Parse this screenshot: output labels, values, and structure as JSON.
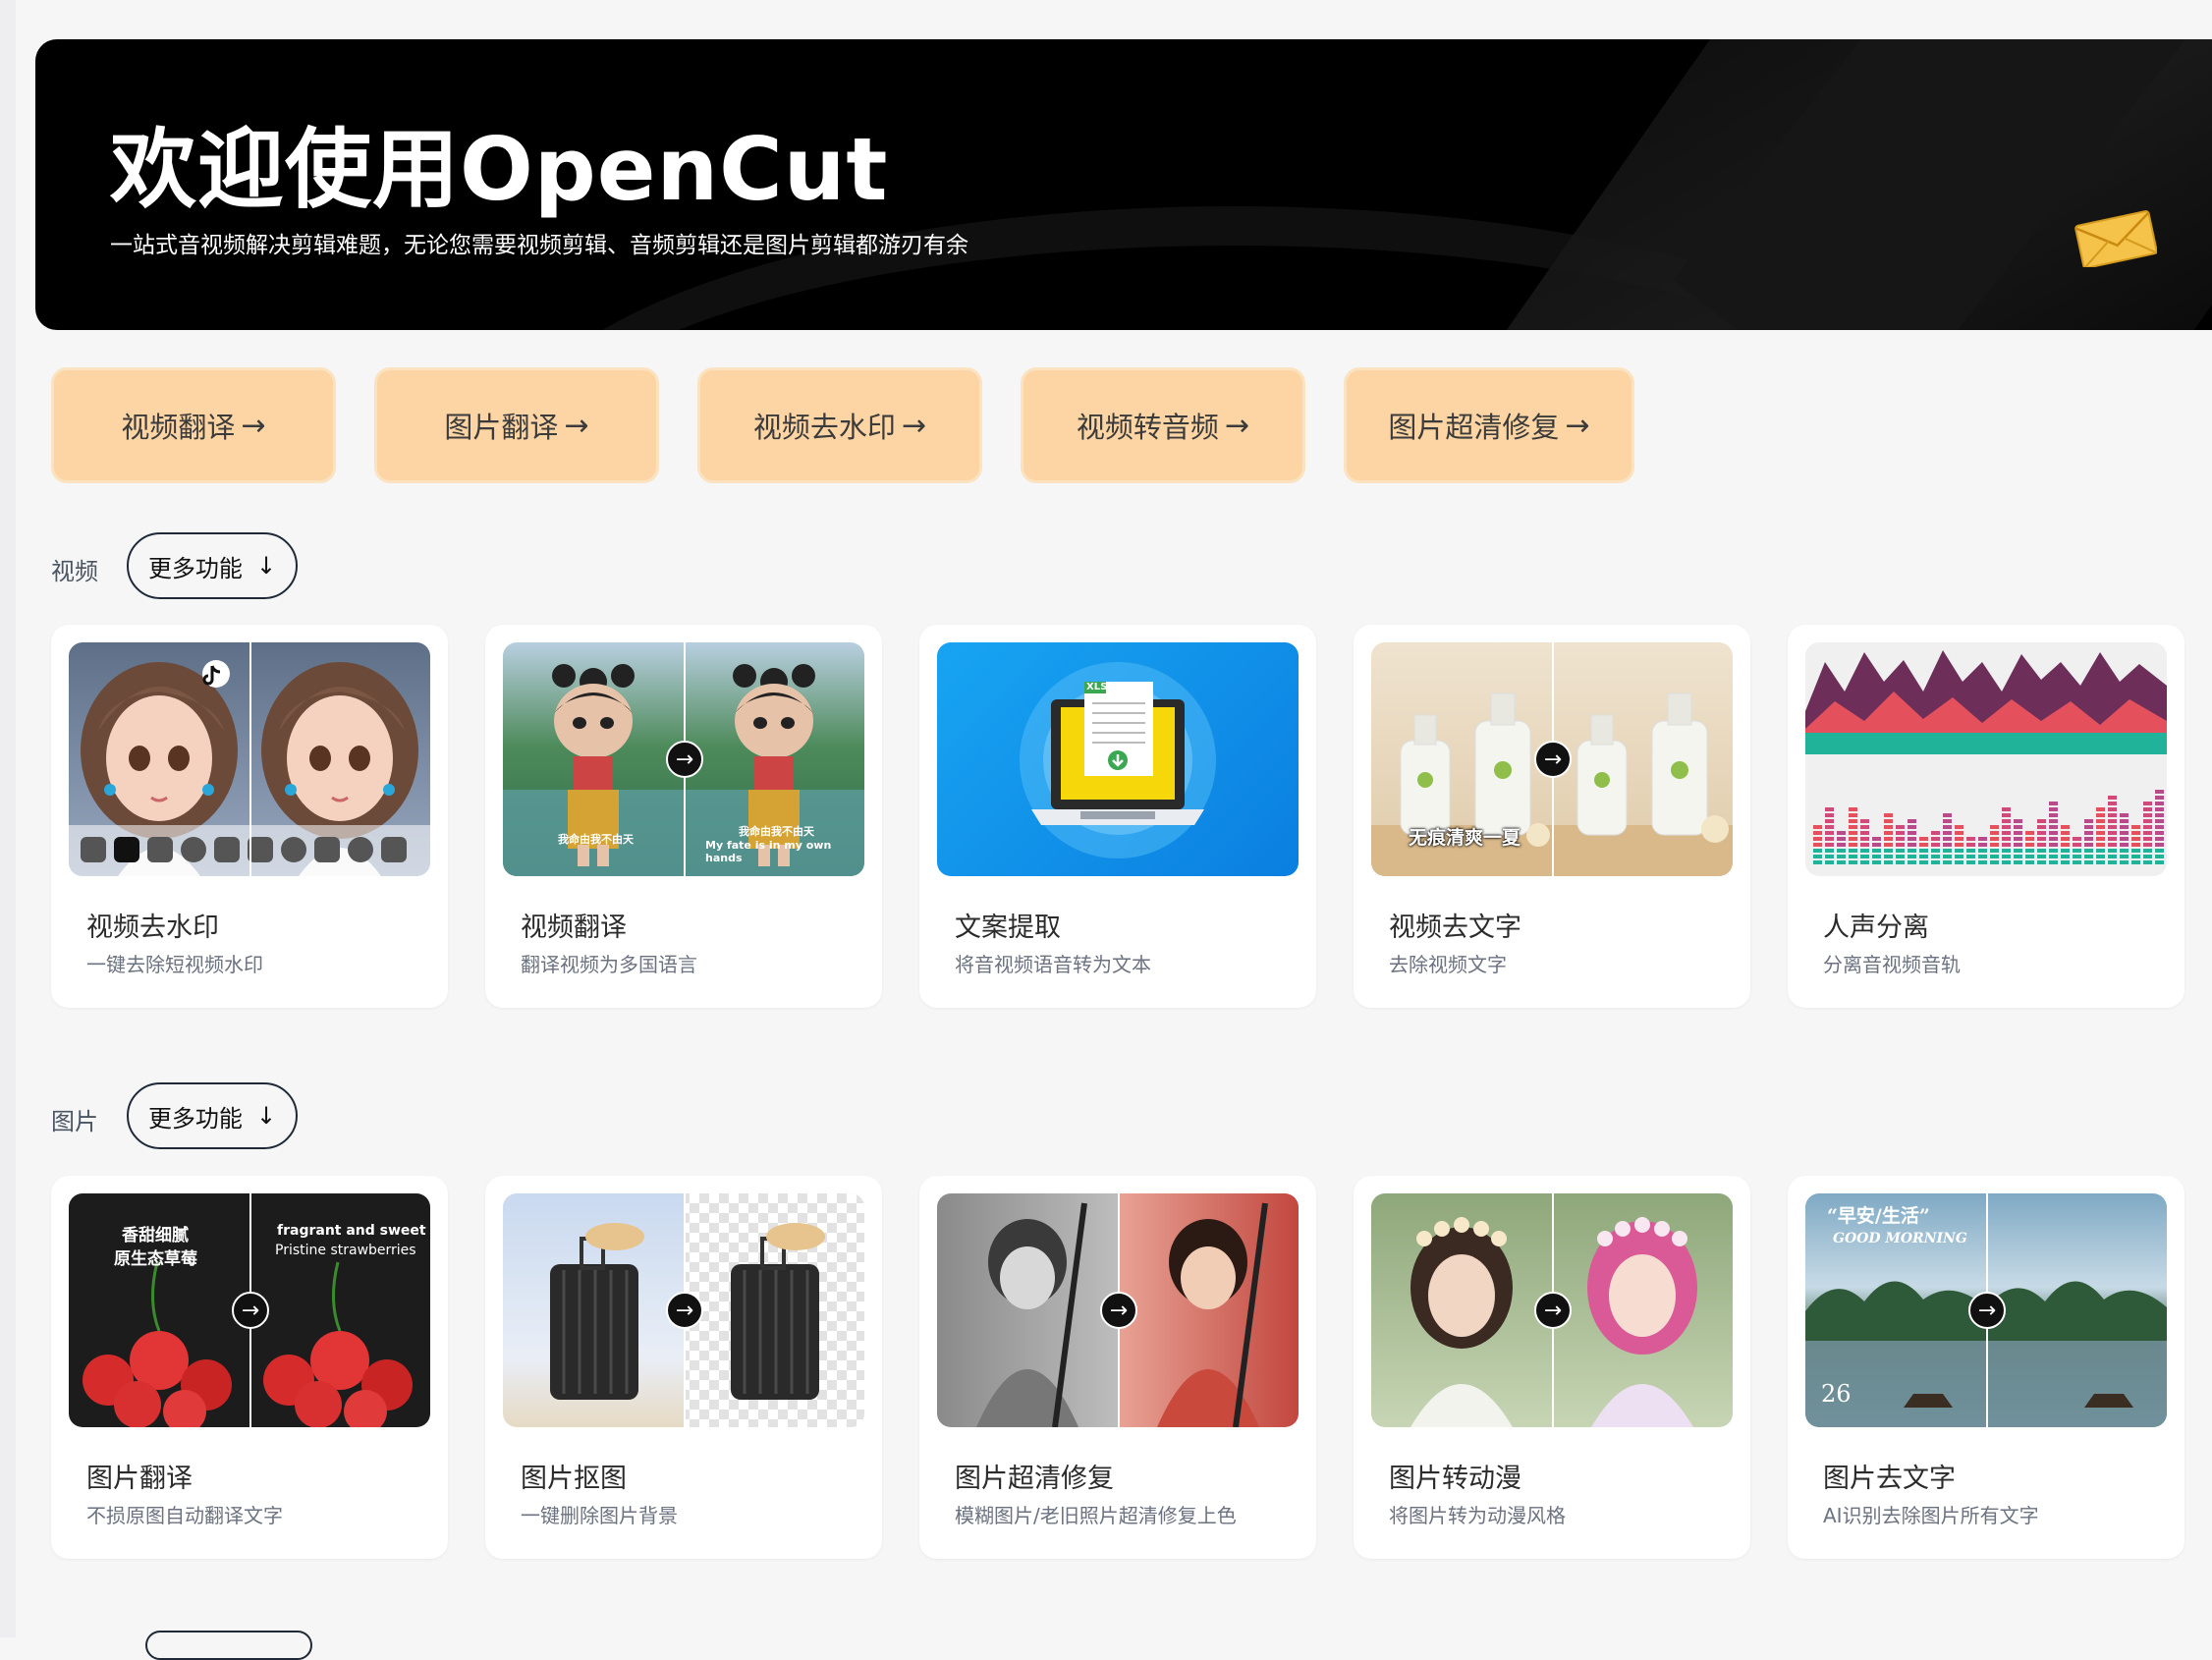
{
  "hero": {
    "title": "欢迎使用OpenCut",
    "subtitle": "一站式音视频解决剪辑难题，无论您需要视频剪辑、音频剪辑还是图片剪辑都游刃有余"
  },
  "quick_links": [
    "视频翻译",
    "图片翻译",
    "视频去水印",
    "视频转音频",
    "图片超清修复"
  ],
  "quick_arrow": "→",
  "sections": {
    "video": {
      "label": "视频",
      "more": "更多功能",
      "cards": [
        {
          "title": "视频去水印",
          "sub": "一键去除短视频水印"
        },
        {
          "title": "视频翻译",
          "sub": "翻译视频为多国语言"
        },
        {
          "title": "文案提取",
          "sub": "将音视频语音转为文本"
        },
        {
          "title": "视频去文字",
          "sub": "去除视频文字"
        },
        {
          "title": "人声分离",
          "sub": "分离音视频音轨"
        }
      ]
    },
    "image": {
      "label": "图片",
      "more": "更多功能",
      "cards": [
        {
          "title": "图片翻译",
          "sub": "不损原图自动翻译文字"
        },
        {
          "title": "图片抠图",
          "sub": "一键删除图片背景"
        },
        {
          "title": "图片超清修复",
          "sub": "模糊图片/老旧照片超清修复上色"
        },
        {
          "title": "图片转动漫",
          "sub": "将图片转为动漫风格"
        },
        {
          "title": "图片去文字",
          "sub": "AI识别去除图片所有文字"
        }
      ]
    }
  },
  "thumb_texts": {
    "nezha_left": "我命由我不由天",
    "nezha_right_cn": "我命由我不由天",
    "nezha_right_en": "My fate is in my own hands",
    "bottles": "无痕清爽一夏",
    "xls": "XLS",
    "straw_cn1": "香甜细腻",
    "straw_cn2": "原生态草莓",
    "straw_en1": "fragrant and sweet",
    "straw_en2": "Pristine strawberries",
    "morning_cn": "“早安/生活”",
    "morning_en": "GOOD MORNING",
    "morning_day": "26"
  },
  "icons": {
    "arrow_down": "↓",
    "circle_arrow": "→"
  },
  "colors": {
    "quick_bg": "#fdd5a4",
    "hero_bg": "#000000"
  }
}
